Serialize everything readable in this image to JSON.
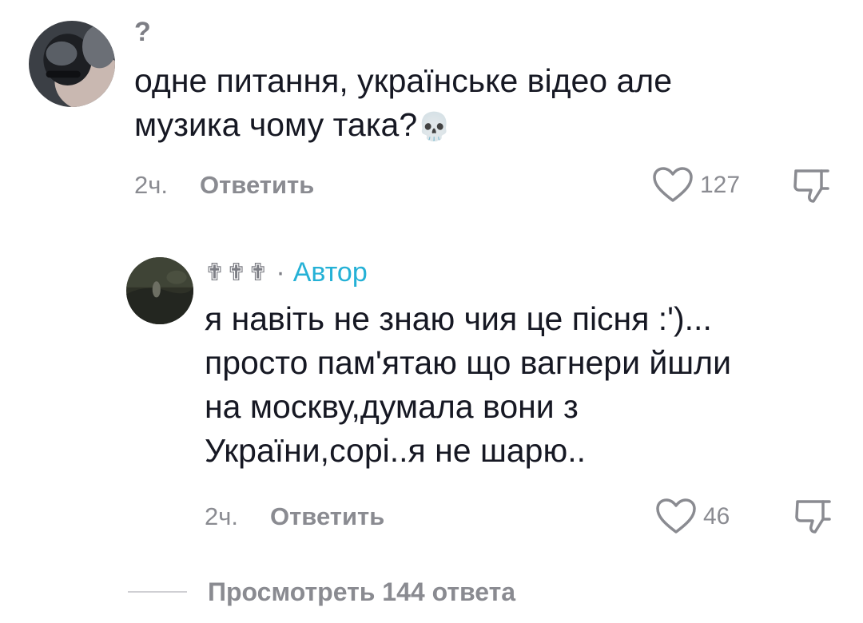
{
  "comments": [
    {
      "username": "?",
      "text_line1": "одне питання, українське відео але",
      "text_line2": "музика чому така?",
      "emoji": "💀",
      "time": "2ч.",
      "reply_label": "Ответить",
      "likes": "127",
      "icons": [
        "avatar",
        "heart-icon",
        "dislike-icon"
      ]
    },
    {
      "username": "✟✟✟",
      "separator": "·",
      "author_badge": "Автор",
      "text_lines": [
        "я навіть не знаю чия це пісня :')...",
        "просто пам'ятаю що вагнери йшли",
        "на москву,думала вони з",
        "України,сорі..я не шарю.."
      ],
      "time": "2ч.",
      "reply_label": "Ответить",
      "likes": "46",
      "icons": [
        "avatar",
        "heart-icon",
        "dislike-icon"
      ]
    }
  ],
  "view_replies": {
    "label": "Просмотреть 144 ответа"
  },
  "colors": {
    "text": "#161823",
    "muted": "#8a8b91",
    "author": "#25b1d6",
    "background": "#ffffff"
  }
}
